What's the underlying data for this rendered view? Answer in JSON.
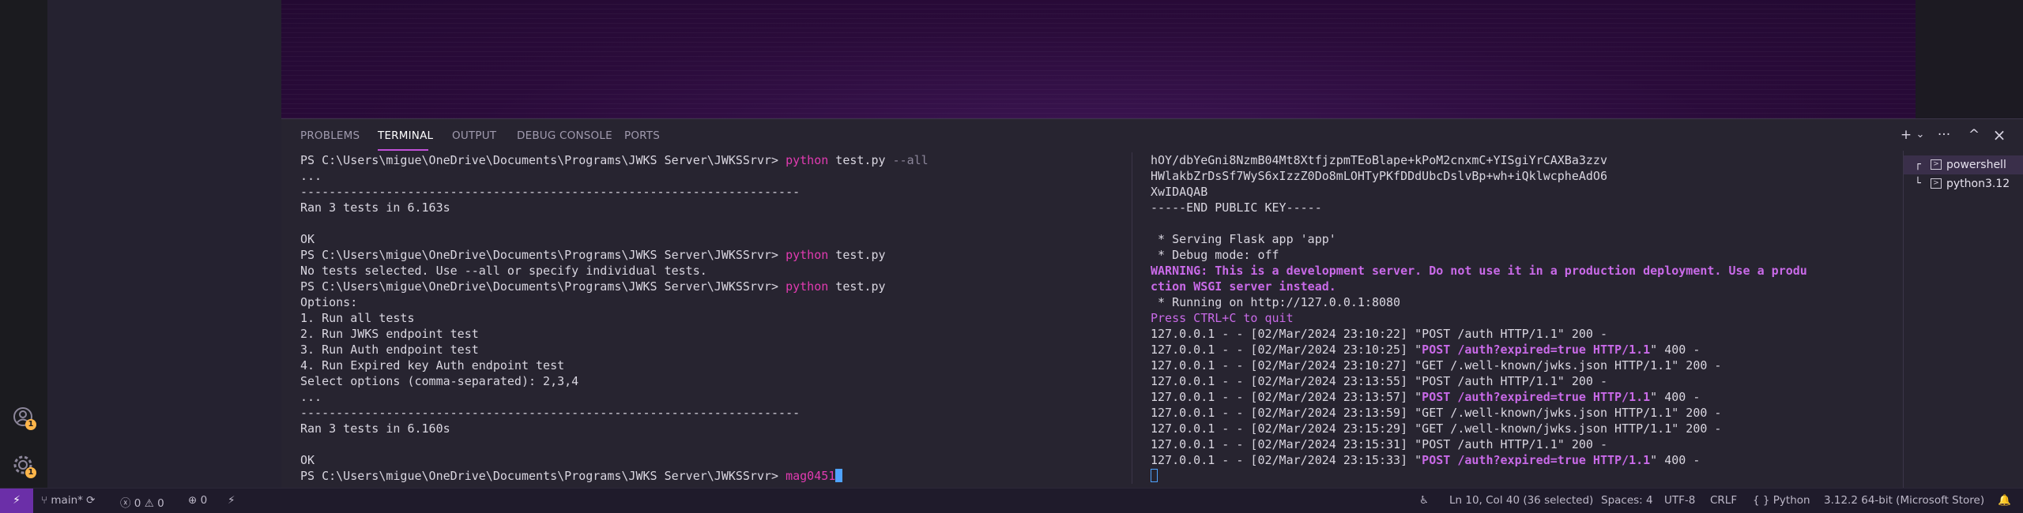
{
  "panel": {
    "tabs": [
      "PROBLEMS",
      "TERMINAL",
      "OUTPUT",
      "DEBUG CONSOLE",
      "PORTS"
    ],
    "active_tab": "TERMINAL",
    "actions": {
      "new_terminal": "+",
      "dropdown": "⌄",
      "more": "···",
      "maximize": "^",
      "close": "×"
    }
  },
  "terminal_left": [
    {
      "segs": [
        {
          "t": "PS C:\\Users\\migue\\OneDrive\\Documents\\Programs\\JWKS Server\\JWKSSrvr> "
        },
        {
          "t": "python",
          "c": "cmd"
        },
        {
          "t": " test.py "
        },
        {
          "t": "--all",
          "c": "dim"
        }
      ]
    },
    {
      "segs": [
        {
          "t": "..."
        }
      ]
    },
    {
      "segs": [
        {
          "t": "----------------------------------------------------------------------"
        }
      ]
    },
    {
      "segs": [
        {
          "t": "Ran 3 tests in 6.163s"
        }
      ]
    },
    {
      "segs": [
        {
          "t": ""
        }
      ]
    },
    {
      "segs": [
        {
          "t": "OK"
        }
      ]
    },
    {
      "segs": [
        {
          "t": "PS C:\\Users\\migue\\OneDrive\\Documents\\Programs\\JWKS Server\\JWKSSrvr> "
        },
        {
          "t": "python",
          "c": "cmd"
        },
        {
          "t": " test.py"
        }
      ]
    },
    {
      "segs": [
        {
          "t": "No tests selected. Use --all or specify individual tests."
        }
      ]
    },
    {
      "segs": [
        {
          "t": "PS C:\\Users\\migue\\OneDrive\\Documents\\Programs\\JWKS Server\\JWKSSrvr> "
        },
        {
          "t": "python",
          "c": "cmd"
        },
        {
          "t": " test.py"
        }
      ]
    },
    {
      "segs": [
        {
          "t": "Options:"
        }
      ]
    },
    {
      "segs": [
        {
          "t": "1. Run all tests"
        }
      ]
    },
    {
      "segs": [
        {
          "t": "2. Run JWKS endpoint test"
        }
      ]
    },
    {
      "segs": [
        {
          "t": "3. Run Auth endpoint test"
        }
      ]
    },
    {
      "segs": [
        {
          "t": "4. Run Expired key Auth endpoint test"
        }
      ]
    },
    {
      "segs": [
        {
          "t": "Select options (comma-separated): 2,3,4"
        }
      ]
    },
    {
      "segs": [
        {
          "t": "..."
        }
      ]
    },
    {
      "segs": [
        {
          "t": "----------------------------------------------------------------------"
        }
      ]
    },
    {
      "segs": [
        {
          "t": "Ran 3 tests in 6.160s"
        }
      ]
    },
    {
      "segs": [
        {
          "t": ""
        }
      ]
    },
    {
      "segs": [
        {
          "t": "OK"
        }
      ]
    },
    {
      "segs": [
        {
          "t": "PS C:\\Users\\migue\\OneDrive\\Documents\\Programs\\JWKS Server\\JWKSSrvr> "
        },
        {
          "t": "mag0451",
          "c": "cmd"
        }
      ],
      "cursor": "solid"
    }
  ],
  "terminal_right": [
    {
      "segs": [
        {
          "t": "hOY/dbYeGni8NzmB04Mt8XtfjzpmTEoBlape+kPoM2cnxmC+YISgiYrCAXBa3zzv"
        }
      ]
    },
    {
      "segs": [
        {
          "t": "HWlakbZrDsSf7WyS6xIzzZ0Do8mLOHTyPKfDDdUbcDslvBp+wh+iQklwcpheAdO6"
        }
      ]
    },
    {
      "segs": [
        {
          "t": "XwIDAQAB"
        }
      ]
    },
    {
      "segs": [
        {
          "t": "-----END PUBLIC KEY-----"
        }
      ]
    },
    {
      "segs": [
        {
          "t": ""
        }
      ]
    },
    {
      "segs": [
        {
          "t": " * Serving Flask app 'app'"
        }
      ]
    },
    {
      "segs": [
        {
          "t": " * Debug mode: off"
        }
      ]
    },
    {
      "segs": [
        {
          "t": "WARNING: This is a development server. Do not use it in a production deployment. Use a produ",
          "c": "warn"
        }
      ]
    },
    {
      "segs": [
        {
          "t": "ction WSGI server instead.",
          "c": "warn"
        }
      ]
    },
    {
      "segs": [
        {
          "t": " * Running on http://127.0.0.1:8080"
        }
      ]
    },
    {
      "segs": [
        {
          "t": "Press CTRL+C to quit",
          "c": "purple"
        }
      ]
    },
    {
      "segs": [
        {
          "t": "127.0.0.1 - - [02/Mar/2024 23:10:22] \"POST /auth HTTP/1.1\" 200 -"
        }
      ]
    },
    {
      "segs": [
        {
          "t": "127.0.0.1 - - [02/Mar/2024 23:10:25] \""
        },
        {
          "t": "POST /auth?expired=true HTTP/1.1",
          "c": "warn"
        },
        {
          "t": "\" 400 -"
        }
      ]
    },
    {
      "segs": [
        {
          "t": "127.0.0.1 - - [02/Mar/2024 23:10:27] \"GET /.well-known/jwks.json HTTP/1.1\" 200 -"
        }
      ]
    },
    {
      "segs": [
        {
          "t": "127.0.0.1 - - [02/Mar/2024 23:13:55] \"POST /auth HTTP/1.1\" 200 -"
        }
      ]
    },
    {
      "segs": [
        {
          "t": "127.0.0.1 - - [02/Mar/2024 23:13:57] \""
        },
        {
          "t": "POST /auth?expired=true HTTP/1.1",
          "c": "warn"
        },
        {
          "t": "\" 400 -"
        }
      ]
    },
    {
      "segs": [
        {
          "t": "127.0.0.1 - - [02/Mar/2024 23:13:59] \"GET /.well-known/jwks.json HTTP/1.1\" 200 -"
        }
      ]
    },
    {
      "segs": [
        {
          "t": "127.0.0.1 - - [02/Mar/2024 23:15:29] \"GET /.well-known/jwks.json HTTP/1.1\" 200 -"
        }
      ]
    },
    {
      "segs": [
        {
          "t": "127.0.0.1 - - [02/Mar/2024 23:15:31] \"POST /auth HTTP/1.1\" 200 -"
        }
      ]
    },
    {
      "segs": [
        {
          "t": "127.0.0.1 - - [02/Mar/2024 23:15:33] \""
        },
        {
          "t": "POST /auth?expired=true HTTP/1.1",
          "c": "warn"
        },
        {
          "t": "\" 400 -"
        }
      ]
    },
    {
      "segs": [
        {
          "t": ""
        }
      ],
      "cursor": "hollow"
    }
  ],
  "terminal_list": [
    {
      "label": "powershell",
      "icon": "terminal-icon",
      "selected": true
    },
    {
      "label": "python3.12",
      "icon": "terminal-icon",
      "selected": false
    }
  ],
  "activity_bar": {
    "accounts_icon": "account-icon",
    "accounts_badge": "1",
    "manage_icon": "gear-icon",
    "manage_badge": "1"
  },
  "status_bar": {
    "remote_icon": "remote-icon",
    "branch": "main*",
    "errors": "0",
    "warnings": "0",
    "ports": "0",
    "cursor_position": "Ln 10, Col 40 (36 selected)",
    "spaces": "Spaces: 4",
    "encoding": "UTF-8",
    "eol": "CRLF",
    "language": "Python",
    "interpreter": "3.12.2 64-bit (Microsoft Store)"
  },
  "colors": {
    "accent": "#c050d8",
    "command": "#e13bb1",
    "warning": "#c96ae8",
    "cursor": "#4fa3ff",
    "remote": "#6b2fa8"
  }
}
